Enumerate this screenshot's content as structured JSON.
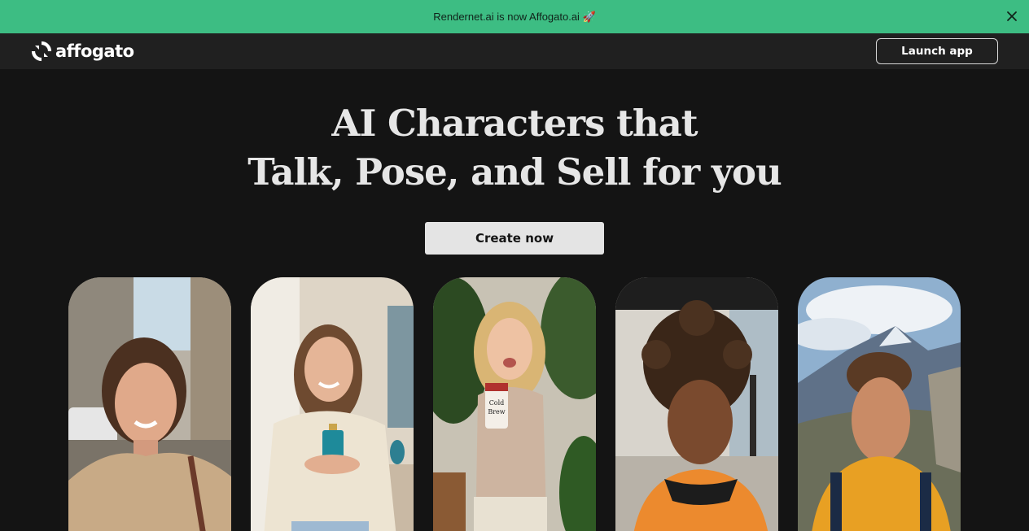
{
  "banner": {
    "text": "Rendernet.ai is now Affogato.ai 🚀",
    "close_icon": "close-icon",
    "background": "#3dbd83"
  },
  "nav": {
    "logo_text": "affogato",
    "logo_icon": "affogato-logo-icon",
    "launch_label": "Launch app"
  },
  "hero": {
    "title_line1": "AI Characters that",
    "title_line2": "Talk, Pose, and Sell for you",
    "cta_label": "Create now"
  },
  "gallery": {
    "cards": [
      {
        "subject": "woman-selfie-city-street"
      },
      {
        "subject": "woman-holding-perfume-bottle"
      },
      {
        "subject": "woman-holding-cold-brew-can"
      },
      {
        "subject": "man-curly-hair-selfie"
      },
      {
        "subject": "man-mountain-hiking-selfie"
      }
    ],
    "can_label_line1": "Cold",
    "can_label_line2": "Brew"
  }
}
